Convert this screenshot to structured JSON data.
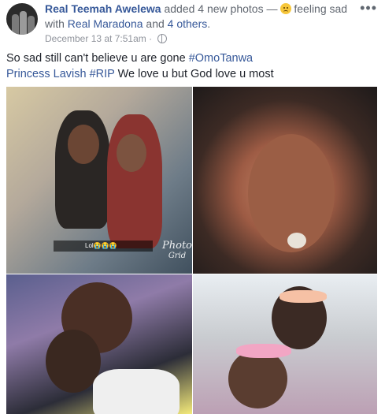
{
  "post": {
    "author": "Real Teemah Awelewa",
    "action": "added 4 new photos —",
    "feeling": "feeling sad",
    "with_prefix": "with",
    "tagged_person": "Real Maradona",
    "and_label": "and",
    "others_link": "4 others",
    "period": ".",
    "timestamp": "December 13 at 7:51am",
    "separator": "·",
    "more_icon": "•••",
    "text_plain": "So sad still can't believe u are gone",
    "hashtag_1": "#OmoTanwa",
    "mention": "Princess Lavish",
    "hashtag_2": "#RIP",
    "text_end": "We love u but God love u most"
  },
  "photos": {
    "photo_1_caption": "Lol😭😭😭",
    "watermark_line_1": "Photo",
    "watermark_line_2": "Grid"
  },
  "icons": {
    "feeling_emoji": "sad-face-icon",
    "privacy": "globe-icon",
    "options": "more-options-icon"
  },
  "colors": {
    "link": "#365899",
    "secondary_text": "#616770",
    "meta_text": "#90949c"
  }
}
